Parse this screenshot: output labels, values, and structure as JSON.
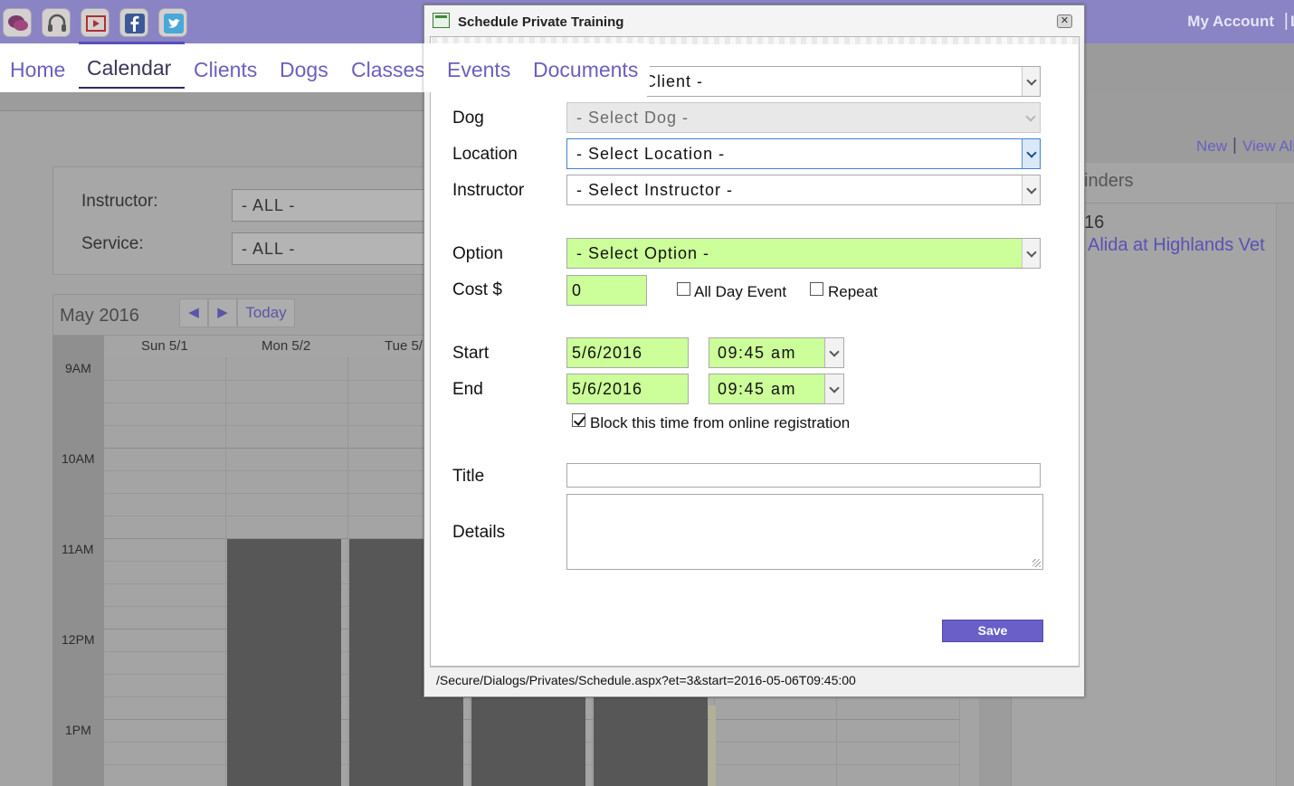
{
  "app": {
    "top_links": {
      "account": "My Account",
      "separator": "|",
      "cut": "L"
    },
    "nav": {
      "items": [
        {
          "label": "Home"
        },
        {
          "label": "Calendar"
        },
        {
          "label": "Clients"
        },
        {
          "label": "Dogs"
        },
        {
          "label": "Classes"
        },
        {
          "label": "Events"
        },
        {
          "label": "Documents"
        }
      ],
      "active": "Calendar"
    },
    "social_icons": [
      "chat-icon",
      "headset-icon",
      "video-icon",
      "facebook-icon",
      "twitter-icon"
    ],
    "filters": {
      "instructor_label": "Instructor:",
      "instructor_value": "- ALL -",
      "service_label": "Service:",
      "service_value": "- ALL -"
    },
    "calendar": {
      "month": "May 2016",
      "prev": "◀",
      "next": "▶",
      "today": "Today",
      "days": [
        "Sun 5/1",
        "Mon 5/2",
        "Tue 5/"
      ],
      "times": [
        "9AM",
        "10AM",
        "11AM",
        "12PM",
        "1PM"
      ]
    },
    "side": {
      "new": "New",
      "sep": "|",
      "view_all": "View All",
      "reminders_title": "inders",
      "reminder_date": "16",
      "reminder_link": "Alida at Highlands Vet"
    }
  },
  "dialog": {
    "title": "Schedule Private Training",
    "close": "✕",
    "fields": {
      "client_value": "- Select Client -",
      "dog_label": "Dog",
      "dog_value": "- Select Dog -",
      "location_label": "Location",
      "location_value": "- Select Location -",
      "instructor_label": "Instructor",
      "instructor_value": "- Select Instructor -",
      "option_label": "Option",
      "option_value": "- Select Option -",
      "cost_label": "Cost $",
      "cost_value": "0",
      "all_day_label": "All Day Event",
      "all_day_checked": false,
      "repeat_label": "Repeat",
      "repeat_checked": false,
      "start_label": "Start",
      "start_date": "5/6/2016",
      "start_time": "09:45 am",
      "end_label": "End",
      "end_date": "5/6/2016",
      "end_time": "09:45 am",
      "block_label": "Block this time from online registration",
      "block_checked": true,
      "title_label": "Title",
      "title_value": "",
      "details_label": "Details",
      "details_value": ""
    },
    "save_label": "Save",
    "status_url": "/Secure/Dialogs/Privates/Schedule.aspx?et=3&start=2016-05-06T09:45:00"
  },
  "colors": {
    "brand_purple": "#8a83c4",
    "link": "#6a5fbf",
    "required_field": "#ccff99",
    "save_button": "#6a5fc9"
  }
}
